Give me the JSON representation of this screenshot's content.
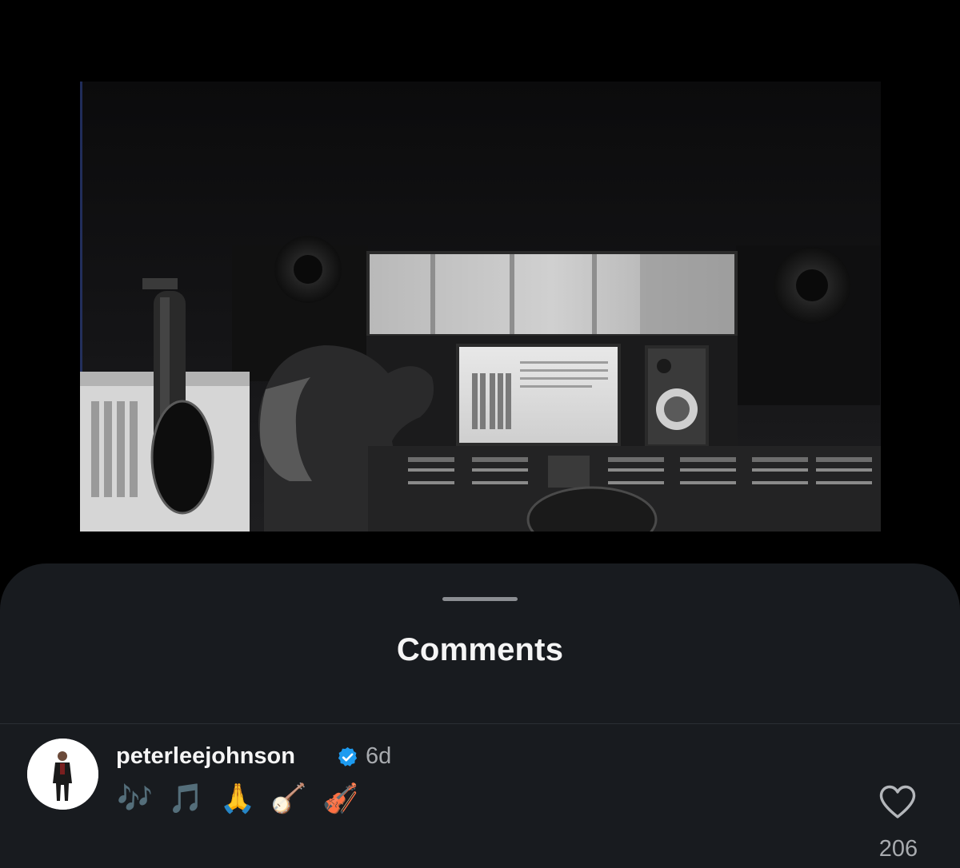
{
  "video": {
    "description_icon": "studio-video-frame"
  },
  "sheet": {
    "title": "Comments"
  },
  "comment": {
    "username": "peterleejohnson",
    "verified_icon": "verified-badge-icon",
    "timestamp": "6d",
    "text": "🎶 🎵 🙏 🪕 🎻",
    "likes": "206",
    "like_icon": "heart-outline-icon"
  },
  "colors": {
    "background": "#000000",
    "sheet": "#181b1f",
    "primary_text": "#f5f5f5",
    "secondary_text": "#a8abaf",
    "verified": "#1d9bf0"
  }
}
